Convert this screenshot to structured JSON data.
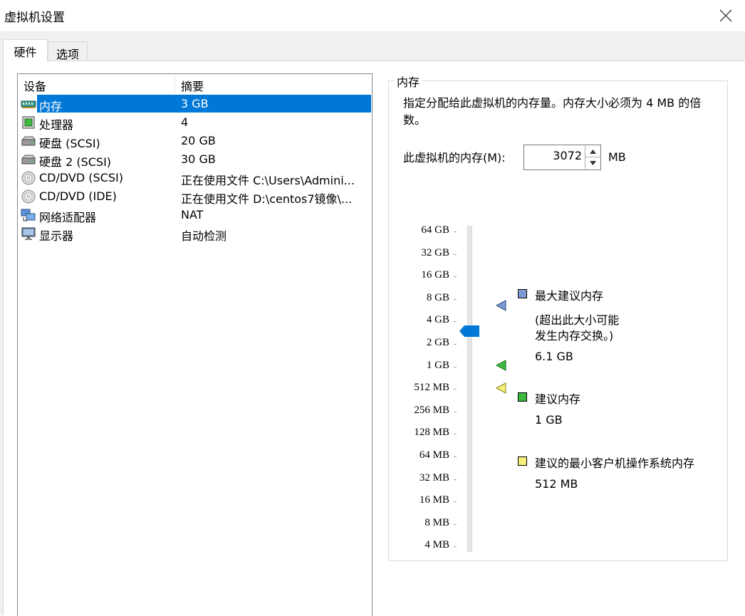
{
  "window": {
    "title": "虚拟机设置",
    "close_icon": "close-icon"
  },
  "tabs": {
    "hardware": "硬件",
    "options": "选项"
  },
  "device_list": {
    "headers": {
      "device": "设备",
      "summary": "摘要"
    },
    "rows": [
      {
        "name": "内存",
        "summary": "3 GB",
        "icon": "memory-icon"
      },
      {
        "name": "处理器",
        "summary": "4",
        "icon": "processor-icon"
      },
      {
        "name": "硬盘 (SCSI)",
        "summary": "20 GB",
        "icon": "hard-disk-icon"
      },
      {
        "name": "硬盘 2 (SCSI)",
        "summary": "30 GB",
        "icon": "hard-disk-icon"
      },
      {
        "name": "CD/DVD (SCSI)",
        "summary": "正在使用文件 C:\\Users\\Admini...",
        "icon": "cd-dvd-icon"
      },
      {
        "name": "CD/DVD (IDE)",
        "summary": "正在使用文件 D:\\centos7镜像\\...",
        "icon": "cd-dvd-icon"
      },
      {
        "name": "网络适配器",
        "summary": "NAT",
        "icon": "network-adapter-icon"
      },
      {
        "name": "显示器",
        "summary": "自动检测",
        "icon": "display-icon"
      }
    ]
  },
  "memory": {
    "group_title": "内存",
    "description": "指定分配给此虚拟机的内存量。内存大小必须为 4 MB 的倍数。",
    "label": "此虚拟机的内存(M):",
    "value": "3072",
    "unit": "MB",
    "scale": [
      "64 GB",
      "32 GB",
      "16 GB",
      "8 GB",
      "4 GB",
      "2 GB",
      "1 GB",
      "512 MB",
      "256 MB",
      "128 MB",
      "64 MB",
      "32 MB",
      "16 MB",
      "8 MB",
      "4 MB"
    ],
    "slider_value": "3 GB",
    "legend": {
      "max": {
        "label": "最大建议内存",
        "note_line1": "(超出此大小可能",
        "note_line2": "发生内存交换。)",
        "value": "6.1 GB",
        "color": "#7b9bd1"
      },
      "recommended": {
        "label": "建议内存",
        "value": "1 GB",
        "color": "#3fb83f"
      },
      "min": {
        "label": "建议的最小客户机操作系统内存",
        "value": "512 MB",
        "color": "#f5f07a"
      }
    },
    "colors": {
      "selection": "#0078d7",
      "thumb": "#0078d7"
    }
  }
}
